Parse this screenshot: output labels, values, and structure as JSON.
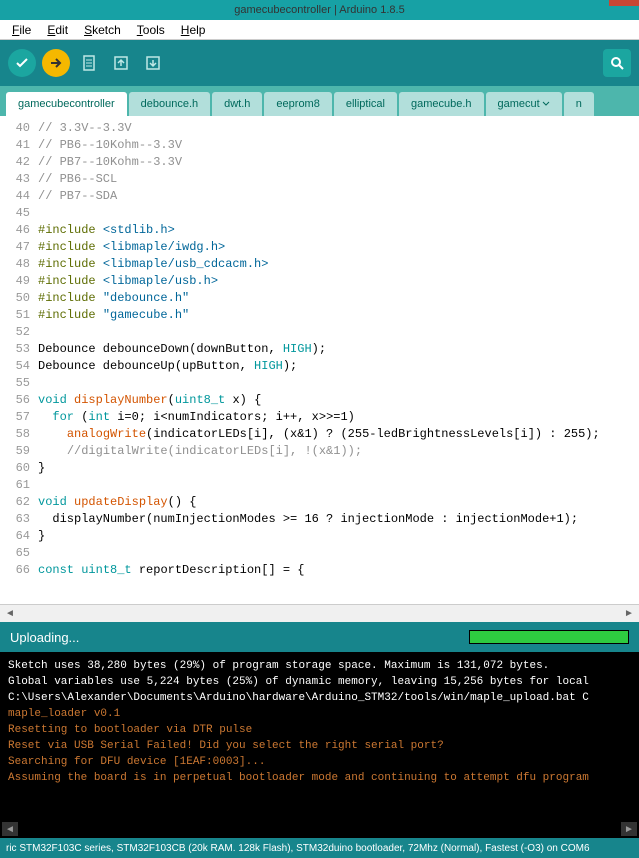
{
  "title": "gamecubecontroller | Arduino 1.8.5",
  "menu": [
    "File",
    "Edit",
    "Sketch",
    "Tools",
    "Help"
  ],
  "tabs": [
    "gamecubecontroller",
    "debounce.h",
    "dwt.h",
    "eeprom8",
    "elliptical",
    "gamecube.h",
    "gamecut",
    "n"
  ],
  "gutter_start": 40,
  "gutter_end": 66,
  "code_lines": [
    {
      "t": "// 3.3V--3.3V",
      "cls": "c-comment"
    },
    {
      "t": "// PB6--10Kohm--3.3V",
      "cls": "c-comment"
    },
    {
      "t": "// PB7--10Kohm--3.3V",
      "cls": "c-comment"
    },
    {
      "t": "// PB6--SCL",
      "cls": "c-comment"
    },
    {
      "t": "// PB7--SDA",
      "cls": "c-comment"
    },
    {
      "t": ""
    },
    {
      "raw": "<span class='c-include'>#include</span> <span class='c-string'>&lt;stdlib.h&gt;</span>"
    },
    {
      "raw": "<span class='c-include'>#include</span> <span class='c-string'>&lt;libmaple/iwdg.h&gt;</span>"
    },
    {
      "raw": "<span class='c-include'>#include</span> <span class='c-string'>&lt;libmaple/usb_cdcacm.h&gt;</span>"
    },
    {
      "raw": "<span class='c-include'>#include</span> <span class='c-string'>&lt;libmaple/usb.h&gt;</span>"
    },
    {
      "raw": "<span class='c-include'>#include</span> <span class='c-string'>\"debounce.h\"</span>"
    },
    {
      "raw": "<span class='c-include'>#include</span> <span class='c-string'>\"gamecube.h\"</span>"
    },
    {
      "t": ""
    },
    {
      "raw": "Debounce debounceDown(downButton, <span class='c-blue'>HIGH</span>);"
    },
    {
      "raw": "Debounce debounceUp(upButton, <span class='c-blue'>HIGH</span>);"
    },
    {
      "t": ""
    },
    {
      "raw": "<span class='c-keyword'>void</span> <span class='c-func'>displayNumber</span>(<span class='c-type'>uint8_t</span> x) {"
    },
    {
      "raw": "  <span class='c-keyword'>for</span> (<span class='c-keyword'>int</span> i=0; i&lt;numIndicators; i++, x&gt;&gt;=1)"
    },
    {
      "raw": "    <span class='c-func'>analogWrite</span>(indicatorLEDs[i], (x&amp;1) ? (255-ledBrightnessLevels[i]) : 255);"
    },
    {
      "raw": "    <span class='c-comment'>//digitalWrite(indicatorLEDs[i], !(x&amp;1));</span>"
    },
    {
      "t": "}"
    },
    {
      "t": ""
    },
    {
      "raw": "<span class='c-keyword'>void</span> <span class='c-func'>updateDisplay</span>() {"
    },
    {
      "raw": "  displayNumber(numInjectionModes &gt;= 16 ? injectionMode : injectionMode+1);"
    },
    {
      "t": "}"
    },
    {
      "t": ""
    },
    {
      "raw": "<span class='c-keyword'>const</span> <span class='c-type'>uint8_t</span> reportDescription[] = {"
    }
  ],
  "status": "Uploading...",
  "progress_pct": 100,
  "console_lines": [
    {
      "t": "Sketch uses 38,280 bytes (29%) of program storage space. Maximum is 131,072 bytes."
    },
    {
      "t": "Global variables use 5,224 bytes (25%) of dynamic memory, leaving 15,256 bytes for local"
    },
    {
      "t": "C:\\Users\\Alexander\\Documents\\Arduino\\hardware\\Arduino_STM32/tools/win/maple_upload.bat C"
    },
    {
      "t": "maple_loader v0.1",
      "cls": "orange"
    },
    {
      "t": "Resetting to bootloader via DTR pulse",
      "cls": "orange"
    },
    {
      "t": "Reset via USB Serial Failed! Did you select the right serial port?",
      "cls": "orange"
    },
    {
      "t": "Searching for DFU device [1EAF:0003]...",
      "cls": "orange"
    },
    {
      "t": "Assuming the board is in perpetual bootloader mode and continuing to attempt dfu program",
      "cls": "orange"
    }
  ],
  "footer": "ric STM32F103C series, STM32F103CB (20k RAM. 128k Flash), STM32duino bootloader, 72Mhz (Normal), Fastest (-O3) on COM6"
}
